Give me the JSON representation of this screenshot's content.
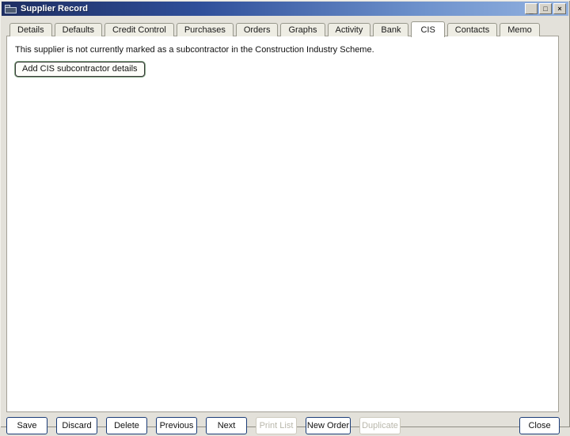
{
  "window": {
    "title": "Supplier Record",
    "controls": {
      "minimize_glyph": "_",
      "maximize_glyph": "□",
      "close_glyph": "×"
    }
  },
  "tabs": [
    {
      "label": "Details",
      "active": false
    },
    {
      "label": "Defaults",
      "active": false
    },
    {
      "label": "Credit Control",
      "active": false
    },
    {
      "label": "Purchases",
      "active": false
    },
    {
      "label": "Orders",
      "active": false
    },
    {
      "label": "Graphs",
      "active": false
    },
    {
      "label": "Activity",
      "active": false
    },
    {
      "label": "Bank",
      "active": false
    },
    {
      "label": "CIS",
      "active": true
    },
    {
      "label": "Contacts",
      "active": false
    },
    {
      "label": "Memo",
      "active": false
    }
  ],
  "content": {
    "message": "This supplier is not currently marked as a subcontractor in the Construction Industry Scheme.",
    "add_button_label": "Add CIS subcontractor details"
  },
  "footer": {
    "buttons": [
      {
        "label": "Save",
        "enabled": true
      },
      {
        "label": "Discard",
        "enabled": true
      },
      {
        "label": "Delete",
        "enabled": true
      },
      {
        "label": "Previous",
        "enabled": true
      },
      {
        "label": "Next",
        "enabled": true
      },
      {
        "label": "Print List",
        "enabled": false
      },
      {
        "label": "New Order",
        "enabled": true
      },
      {
        "label": "Duplicate",
        "enabled": false
      }
    ],
    "close_label": "Close"
  },
  "colors": {
    "titlebar_gradient_start": "#1e2e62",
    "titlebar_gradient_end": "#93b2e0",
    "window_background": "#e3e1da",
    "tab_background": "#eeede4",
    "tab_border": "#98988c",
    "panel_background": "#ffffff",
    "focus_button_outline_green": "#84a584",
    "footer_button_border": "#1b3c77",
    "disabled_text": "#b9b7ab"
  }
}
